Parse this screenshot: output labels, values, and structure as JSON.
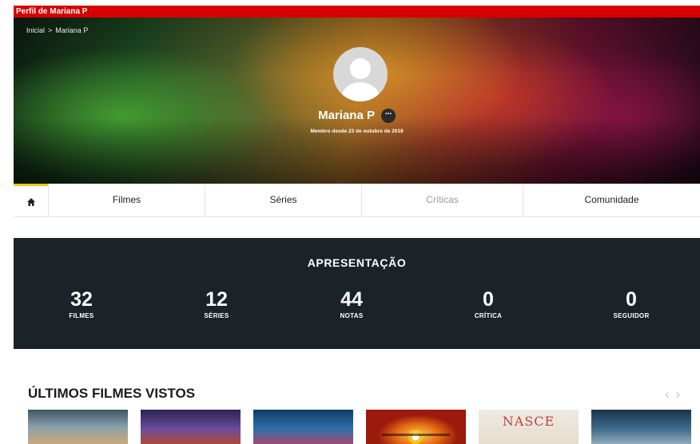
{
  "window": {
    "title": "Perfil de Mariana P"
  },
  "breadcrumb": {
    "home": "Inicial",
    "separator": ">",
    "current": "Mariana P"
  },
  "profile": {
    "name": "Mariana P",
    "more_icon": "ellipsis-icon",
    "more_glyph": "···",
    "member_since": "Membro desde 23 de outubro de 2018"
  },
  "tabs": {
    "home_icon": "home-icon",
    "items": [
      {
        "label": "Filmes"
      },
      {
        "label": "Séries"
      },
      {
        "label": "Críticas"
      },
      {
        "label": "Comunidade"
      }
    ]
  },
  "stats": {
    "title": "APRESENTAÇÃO",
    "items": [
      {
        "value": "32",
        "label": "FILMES"
      },
      {
        "value": "12",
        "label": "SÉRIES"
      },
      {
        "value": "44",
        "label": "NOTAS"
      },
      {
        "value": "0",
        "label": "CRÍTICA"
      },
      {
        "value": "0",
        "label": "SEGUIDOR"
      }
    ]
  },
  "recent": {
    "title": "ÚLTIMOS FILMES VISTOS",
    "prev_glyph": "‹",
    "next_glyph": "›",
    "poster5_text": "NASCE"
  },
  "colors": {
    "topbar": "#d60000",
    "stats_background": "#1b2329",
    "active_tab_accent": "#f5c518"
  }
}
